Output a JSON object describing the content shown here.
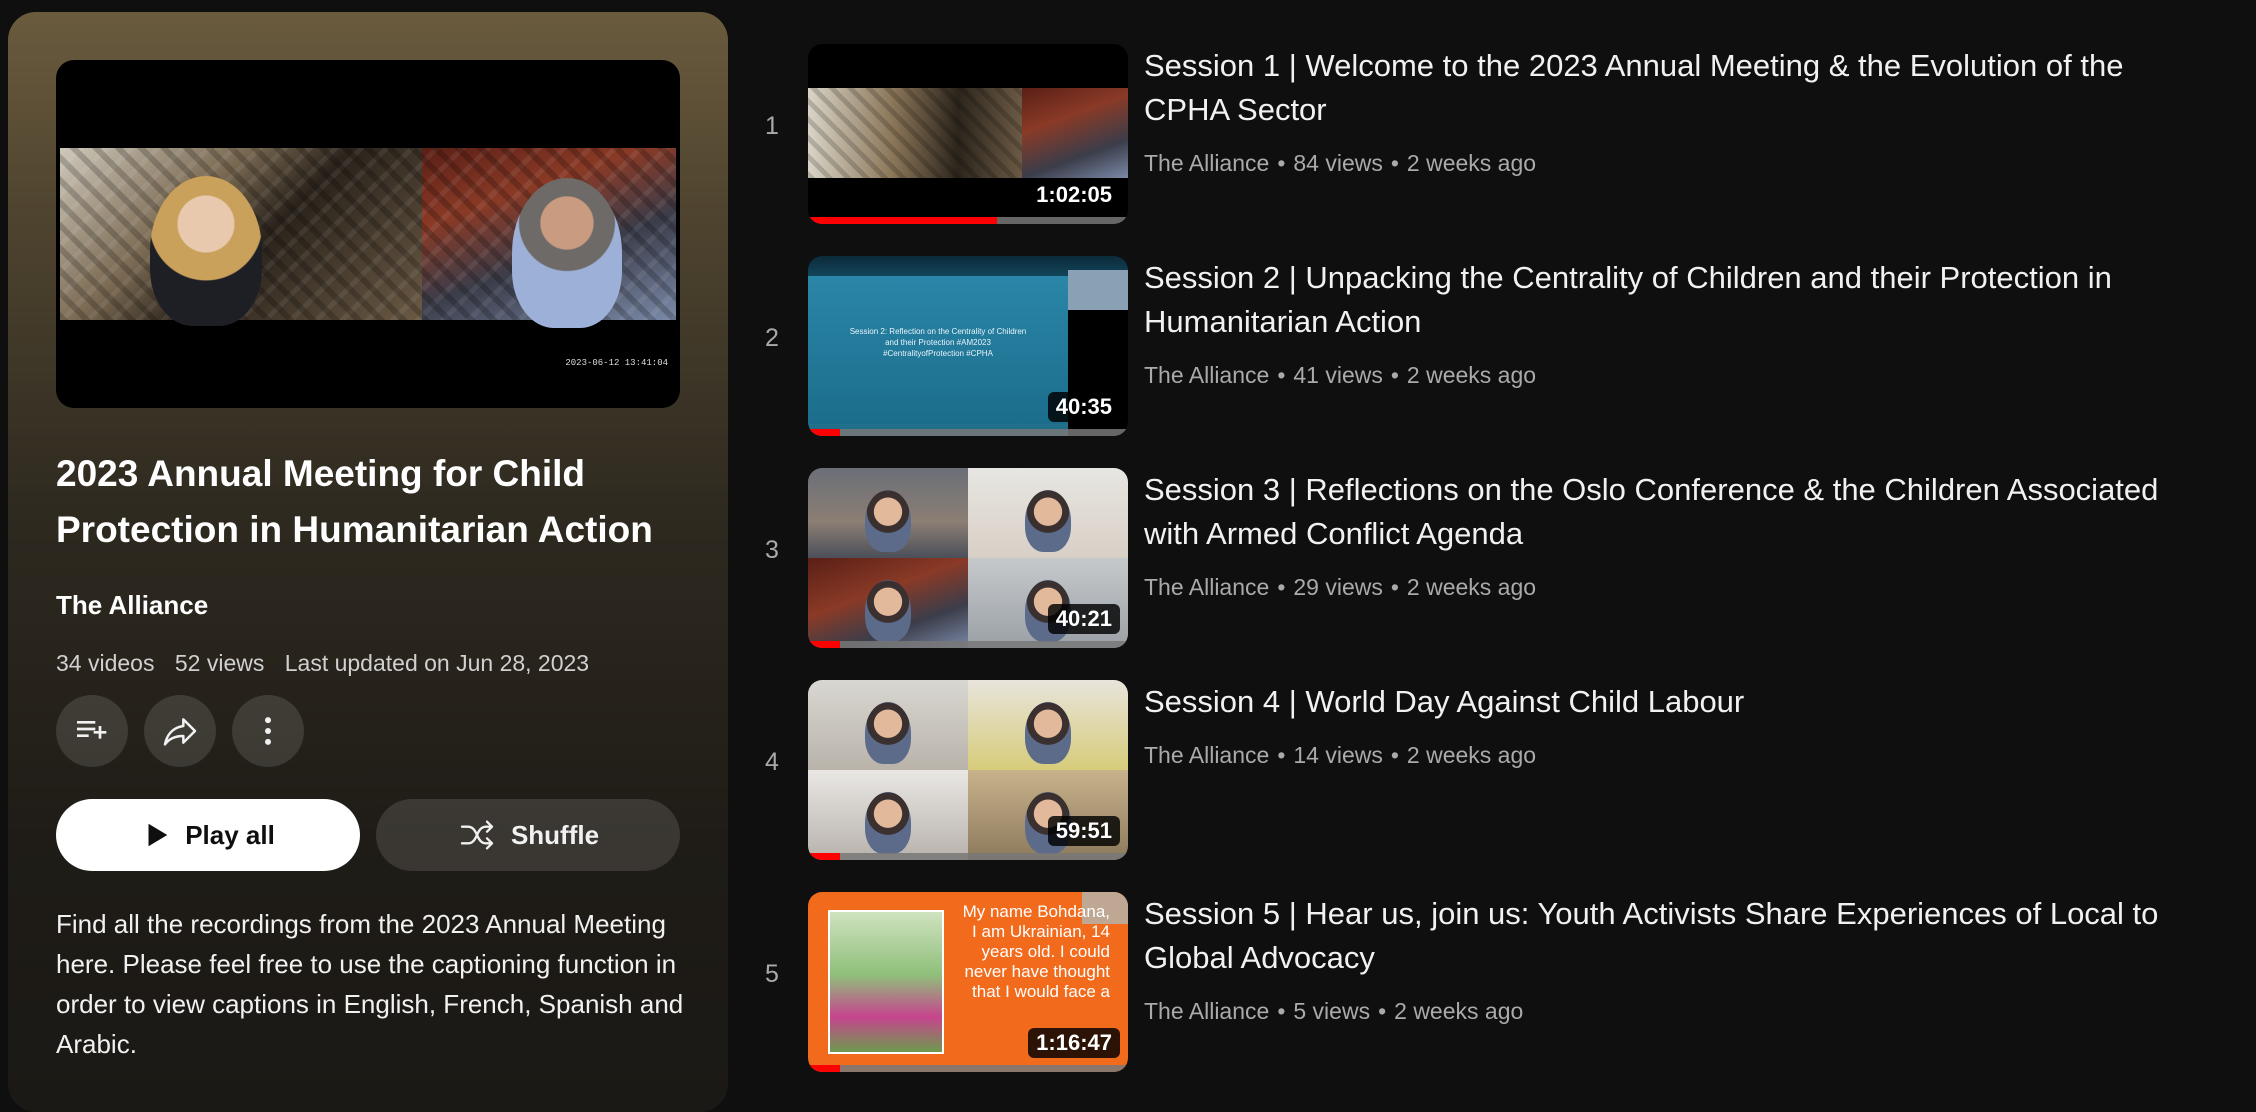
{
  "playlist": {
    "title": "2023 Annual Meeting for Child Protection in Humanitarian Action",
    "channel": "The Alliance",
    "video_count": "34 videos",
    "views": "52 views",
    "updated": "Last updated on Jun 28, 2023",
    "play_all_label": "Play all",
    "shuffle_label": "Shuffle",
    "description": "Find all the recordings from the 2023 Annual Meeting here. Please feel free to use the captioning function in order to view captions in English, French, Spanish and Arabic.",
    "hero_timestamp": "2023-06-12 13:41:04",
    "icons": [
      "add-to-queue-icon",
      "share-icon",
      "more-vert-icon",
      "play-icon",
      "shuffle-icon"
    ]
  },
  "videos": [
    {
      "index": "1",
      "title": "Session 1 | Welcome to the 2023 Annual Meeting & the Evolution of the CPHA Sector",
      "channel": "The Alliance",
      "views": "84 views",
      "age": "2 weeks ago",
      "duration": "1:02:05",
      "watched_fraction": 0.59
    },
    {
      "index": "2",
      "title": "Session 2 | Unpacking the Centrality of Children and their Protection in Humanitarian Action",
      "channel": "The Alliance",
      "views": "41 views",
      "age": "2 weeks ago",
      "duration": "40:35",
      "watched_fraction": 0.1,
      "slide_text": "Session 2: Reflection on the Centrality of Children and their Protection #AM2023 #CentralityofProtection #CPHA"
    },
    {
      "index": "3",
      "title": "Session 3 | Reflections on the Oslo Conference & the Children Associated with Armed Conflict Agenda",
      "channel": "The Alliance",
      "views": "29 views",
      "age": "2 weeks ago",
      "duration": "40:21",
      "watched_fraction": 0.1
    },
    {
      "index": "4",
      "title": "Session 4 | World Day Against Child Labour",
      "channel": "The Alliance",
      "views": "14 views",
      "age": "2 weeks ago",
      "duration": "59:51",
      "watched_fraction": 0.1
    },
    {
      "index": "5",
      "title": "Session 5 | Hear us, join us: Youth Activists Share Experiences of Local to Global Advocacy",
      "channel": "The Alliance",
      "views": "5 views",
      "age": "2 weeks ago",
      "duration": "1:16:47",
      "watched_fraction": 0.1,
      "thumb_text": "My name Bohdana, I am Ukrainian, 14 years old. I could never have thought that I would face a"
    }
  ],
  "colors": {
    "background": "#0f0f0f",
    "progress": "#ff0000",
    "secondary_text": "#aaaaaa"
  }
}
